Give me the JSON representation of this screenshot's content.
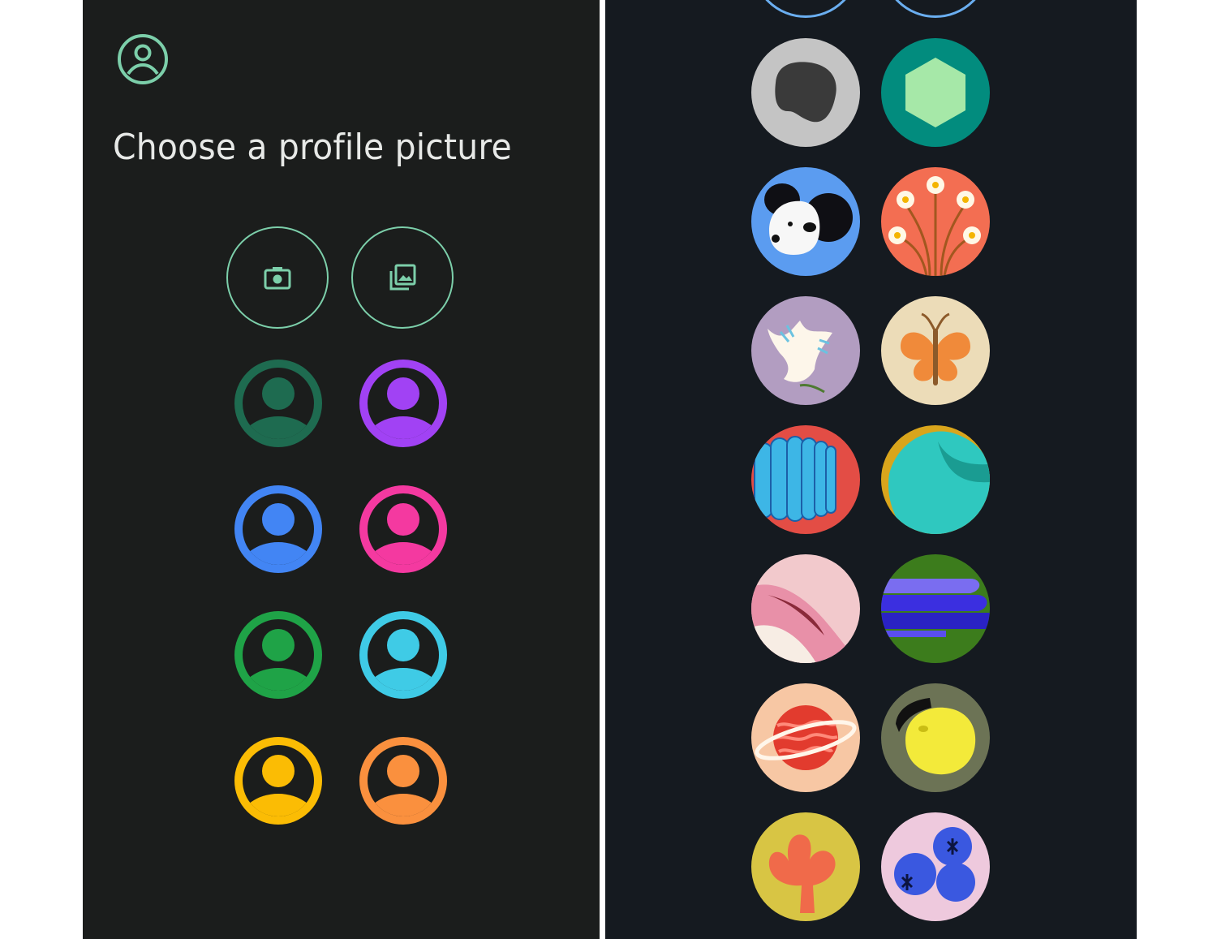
{
  "header": {
    "icon": "account-circle-icon",
    "title": "Choose a profile picture"
  },
  "actions": [
    {
      "name": "take-photo-button",
      "icon": "camera-icon"
    },
    {
      "name": "choose-from-gallery-button",
      "icon": "photo-library-icon"
    }
  ],
  "default_avatars": [
    {
      "name": "avatar-dark-green",
      "color": "#1e6b50",
      "head": "#1e6b50"
    },
    {
      "name": "avatar-purple",
      "color": "#a142f4",
      "head": "#a142f4"
    },
    {
      "name": "avatar-blue",
      "color": "#4285f4",
      "head": "#4285f4"
    },
    {
      "name": "avatar-pink",
      "color": "#f439a0",
      "head": "#f439a0"
    },
    {
      "name": "avatar-green",
      "color": "#1fa347",
      "head": "#1fa347"
    },
    {
      "name": "avatar-cyan",
      "color": "#3fcbe6",
      "head": "#3fcbe6"
    },
    {
      "name": "avatar-yellow",
      "color": "#fbbc04",
      "head": "#fbbc04"
    },
    {
      "name": "avatar-orange",
      "color": "#fa903e",
      "head": "#fa903e"
    }
  ],
  "illustrated_avatars": [
    {
      "name": "avatar-blob",
      "icon": "gray-blob-icon",
      "bg": "#c4c4c4"
    },
    {
      "name": "avatar-hexagon",
      "icon": "hexagon-icon",
      "bg": "#028c7e"
    },
    {
      "name": "avatar-dog",
      "icon": "dog-icon",
      "bg": "#5b9cf0"
    },
    {
      "name": "avatar-flowers",
      "icon": "flowers-icon",
      "bg": "#f36e52"
    },
    {
      "name": "avatar-dove",
      "icon": "dove-icon",
      "bg": "#b29dc1"
    },
    {
      "name": "avatar-butterfly",
      "icon": "butterfly-icon",
      "bg": "#ecdcb8"
    },
    {
      "name": "avatar-fan",
      "icon": "fan-icon",
      "bg": "#e34d45"
    },
    {
      "name": "avatar-wave",
      "icon": "wave-icon",
      "bg": "#d9a51c"
    },
    {
      "name": "avatar-pink-folds",
      "icon": "pink-folds-icon",
      "bg": "#f2c9cc"
    },
    {
      "name": "avatar-blue-steps",
      "icon": "blue-steps-icon",
      "bg": "#3c7c1c"
    },
    {
      "name": "avatar-planet",
      "icon": "planet-icon",
      "bg": "#f7c7a4"
    },
    {
      "name": "avatar-lemon",
      "icon": "lemon-icon",
      "bg": "#6c7355"
    },
    {
      "name": "avatar-coral",
      "icon": "coral-icon",
      "bg": "#d8c544"
    },
    {
      "name": "avatar-blueberries",
      "icon": "blueberries-icon",
      "bg": "#eec9dd"
    }
  ]
}
